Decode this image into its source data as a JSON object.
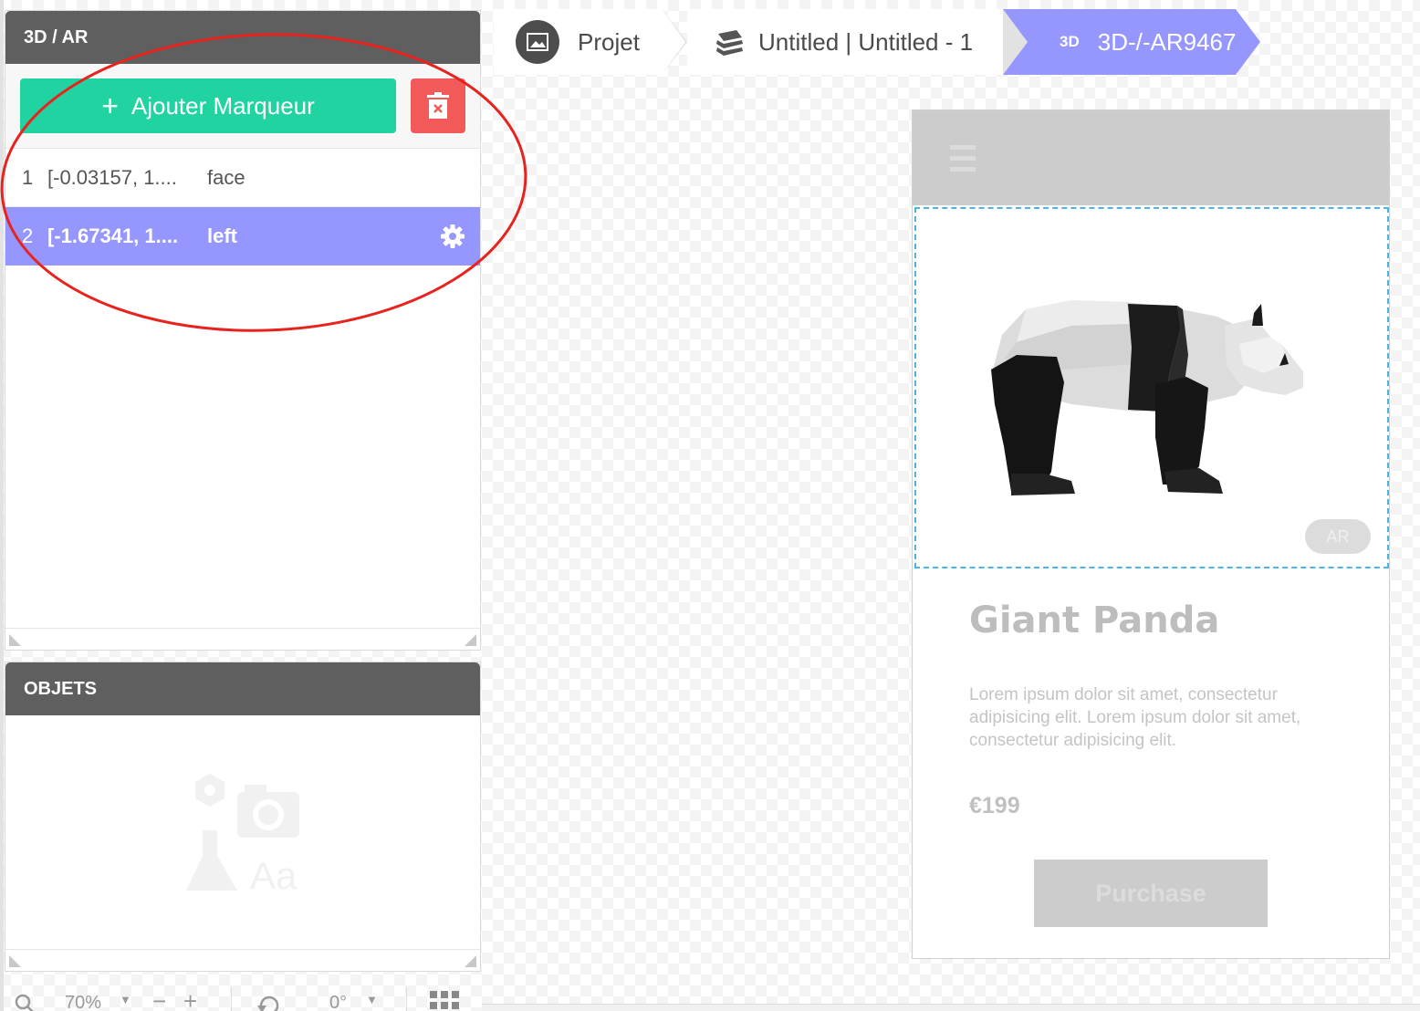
{
  "ar_panel": {
    "title": "3D / AR",
    "add_marker_label": "Ajouter Marqueur",
    "markers": [
      {
        "index": "1",
        "coords": "[-0.03157, 1....",
        "side": "face",
        "selected": false
      },
      {
        "index": "2",
        "coords": "[-1.67341, 1....",
        "side": "left",
        "selected": true
      }
    ]
  },
  "objects_panel": {
    "title": "OBJETS",
    "empty_icon_text": "Aa"
  },
  "statusbar": {
    "zoom": "70%",
    "rotation": "0°"
  },
  "breadcrumb": {
    "project_label": "Projet",
    "file_label": "Untitled | Untitled - 1",
    "active_badge": "3D",
    "active_label": "3D-/-AR9467"
  },
  "preview": {
    "ar_badge": "AR",
    "title": "Giant Panda",
    "description": "Lorem ipsum dolor sit amet, consectetur adipisicing elit. Lorem ipsum dolor sit amet, consectetur adipisicing elit.",
    "price": "€199",
    "purchase_label": "Purchase"
  },
  "colors": {
    "accent_green": "#22d3a2",
    "delete_red": "#f25a5a",
    "selection_purple": "#9696ff",
    "panel_header": "#5f5f5f",
    "annotation_red": "#e8231e"
  }
}
